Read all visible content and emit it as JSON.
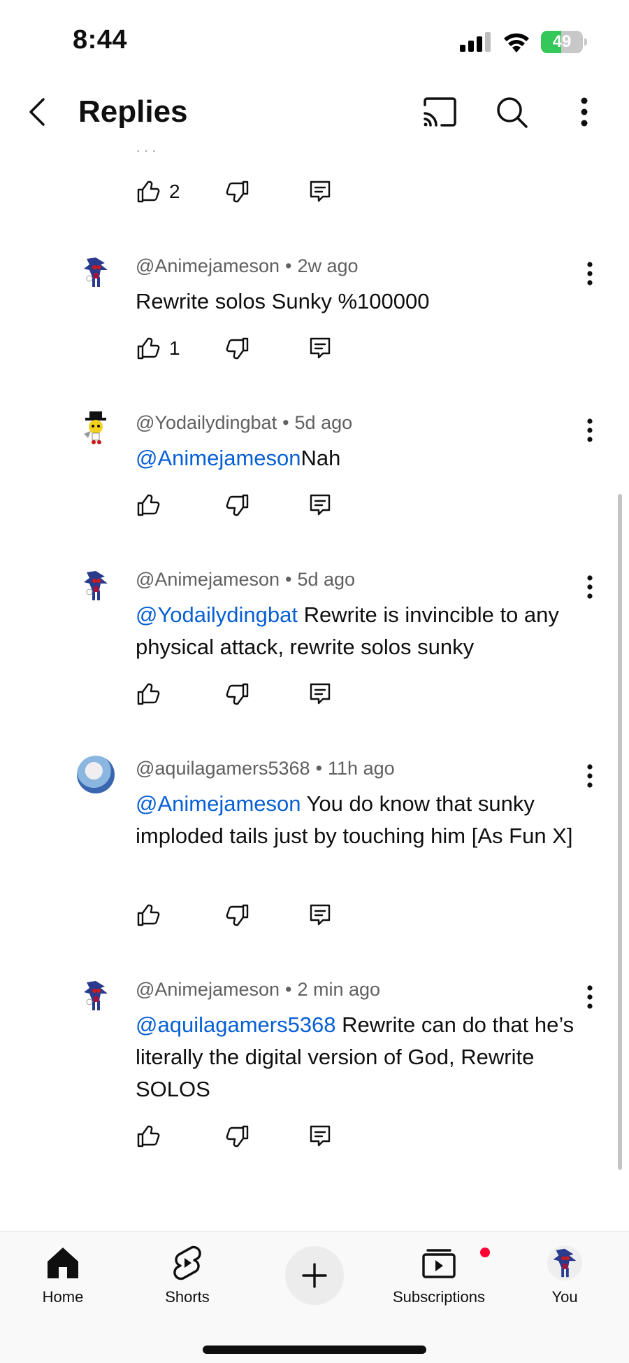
{
  "status_bar": {
    "time": "8:44",
    "battery_level": "49",
    "battery_fraction": 0.49
  },
  "header": {
    "title": "Replies"
  },
  "top_partial": {
    "likes": "2"
  },
  "comments": [
    {
      "author": "@Animejameson",
      "time": "2w ago",
      "mention": "",
      "text": "Rewrite solos Sunky %100000",
      "likes": "1",
      "avatar": "sonic-exe-avatar"
    },
    {
      "author": "@Yodailydingbat",
      "time": "5d ago",
      "mention": "@Animejameson",
      "text": "Nah",
      "likes": "",
      "avatar": "dingbat-avatar"
    },
    {
      "author": "@Animejameson",
      "time": "5d ago",
      "mention": "@Yodailydingbat",
      "text": " Rewrite is invincible to any physical attack, rewrite solos sunky",
      "likes": "",
      "avatar": "sonic-exe-avatar"
    },
    {
      "author": "@aquilagamers5368",
      "time": "11h ago",
      "mention": "@Animejameson",
      "text": " You do know that sunky imploded tails just by touching him [As Fun X]",
      "likes": "",
      "avatar": "photo-avatar"
    },
    {
      "author": "@Animejameson",
      "time": "2 min ago",
      "mention": "@aquilagamers5368",
      "text": " Rewrite can do that he’s literally the digital version of God, Rewrite SOLOS",
      "likes": "",
      "avatar": "sonic-exe-avatar"
    }
  ],
  "separator": "•",
  "bottom_nav": {
    "home": "Home",
    "shorts": "Shorts",
    "subscriptions": "Subscriptions",
    "you": "You"
  },
  "colors": {
    "mention": "#065fd4",
    "accent_red": "#ff0033",
    "battery_green": "#34c759"
  }
}
